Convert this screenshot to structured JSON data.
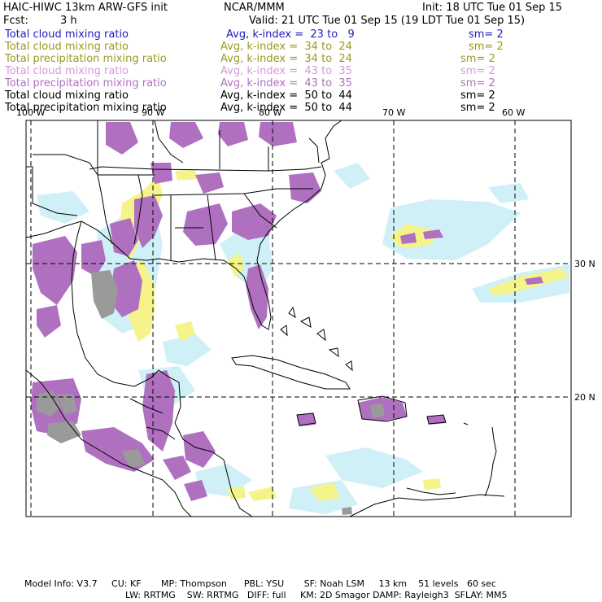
{
  "header": {
    "model_title": "HAIC-HIWC 13km ARW-GFS init",
    "org": "NCAR/MMM",
    "init": "Init: 18 UTC Tue 01 Sep 15",
    "fcst_label": "Fcst:",
    "fcst_value": "3 h",
    "valid": "Valid: 21 UTC Tue 01 Sep 15 (19 LDT Tue 01 Sep 15)"
  },
  "fields": [
    {
      "name": "Total cloud mixing ratio",
      "stat": "Avg, k-index =  23 to   9",
      "sm": "sm= 2",
      "color": "#2020c0"
    },
    {
      "name": "Total cloud mixing ratio",
      "stat": "Avg, k-index =  34 to  24",
      "sm": "sm= 2",
      "color": "#9a9a20"
    },
    {
      "name": "Total precipitation mixing ratio",
      "stat": "Avg, k-index =  34 to  24",
      "sm": "sm= 2",
      "color": "#9a9a20"
    },
    {
      "name": "Total cloud mixing ratio",
      "stat": "Avg, k-index =  43 to  35",
      "sm": "sm= 2",
      "color": "#d898d8"
    },
    {
      "name": "Total precipitation mixing ratio",
      "stat": "Avg, k-index =  43 to  35",
      "sm": "sm= 2",
      "color": "#b070c0"
    },
    {
      "name": "Total cloud mixing ratio",
      "stat": "Avg, k-index =  50 to  44",
      "sm": "sm= 2",
      "color": "#000000"
    },
    {
      "name": "Total precipitation mixing ratio",
      "stat": "Avg, k-index =  50 to  44",
      "sm": "sm= 2",
      "color": "#000000"
    }
  ],
  "map": {
    "lon_labels": [
      "100 W",
      "90 W",
      "80 W",
      "70 W",
      "60 W"
    ],
    "lat_labels": [
      "30 N",
      "20 N"
    ],
    "colors": {
      "cloud_light": "#d0f0f8",
      "cloud_mid": "#f4f48a",
      "precip_mid": "#b070c0",
      "precip_high": "#9a9a9a",
      "gridline": "#000000"
    }
  },
  "footer": {
    "line1": "Model Info: V3.7     CU: KF       MP: Thompson      PBL: YSU       SF: Noah LSM     13 km    51 levels   60 sec",
    "line2": "LW: RRTMG    SW: RRTMG   DIFF: full     KM: 2D Smagor DAMP: Rayleigh3  SFLAY: MM5"
  }
}
